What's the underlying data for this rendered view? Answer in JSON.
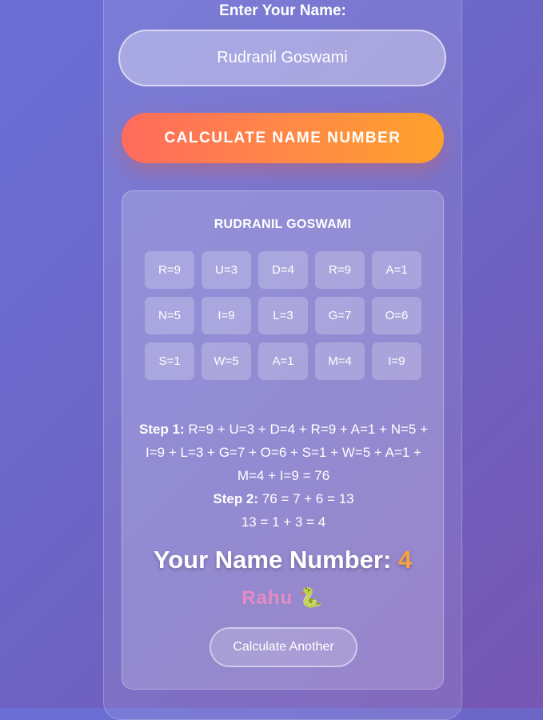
{
  "form": {
    "label": "Enter Your Name:",
    "name_value": "Rudranil Goswami",
    "calculate_button": "CALCULATE NAME NUMBER"
  },
  "result": {
    "name_upper": "RUDRANIL GOSWAMI",
    "letters": [
      "R=9",
      "U=3",
      "D=4",
      "R=9",
      "A=1",
      "N=5",
      "I=9",
      "L=3",
      "G=7",
      "O=6",
      "S=1",
      "W=5",
      "A=1",
      "M=4",
      "I=9"
    ],
    "step1_label": "Step 1:",
    "step1_text": "R=9 + U=3 + D=4 + R=9 + A=1 + N=5 + I=9 + L=3 + G=7 + O=6 + S=1 + W=5 + A=1 + M=4 + I=9 = 76",
    "step2_label": "Step 2:",
    "step2_text": "76 = 7 + 6 = 13",
    "step3_text": "13 = 1 + 3 = 4",
    "number_label": "Your Name Number:",
    "number_value": "4",
    "planet": "Rahu",
    "planet_icon": "snake-icon",
    "again_button": "Calculate Another"
  },
  "colors": {
    "button_gradient_start": "#ff6b5d",
    "button_gradient_end": "#ffa12c",
    "number_accent": "#f7a23a",
    "planet_color": "#e58bc4"
  }
}
